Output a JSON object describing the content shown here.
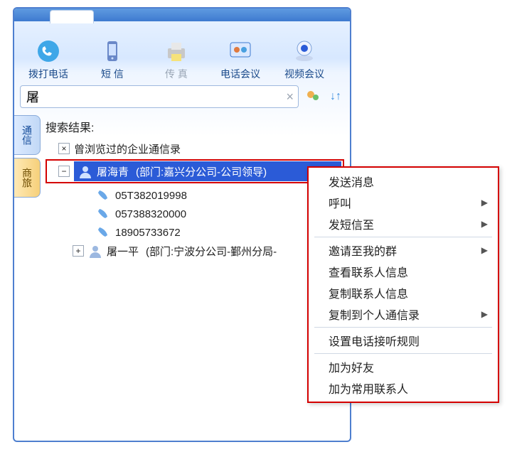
{
  "toolbar": {
    "dial": {
      "label": "拨打电话"
    },
    "sms": {
      "label": "短 信"
    },
    "fax": {
      "label": "传 真"
    },
    "conf": {
      "label": "电话会议"
    },
    "video": {
      "label": "视频会议"
    }
  },
  "search": {
    "value": "屠"
  },
  "side_tabs": {
    "tab1": "通信",
    "tab2": "商旅"
  },
  "tree": {
    "title": "搜索结果:",
    "node1": "曾浏览过的企业通信录",
    "sel_name": "屠海青",
    "sel_dept": "(部门:嘉兴分公司-公司领导)",
    "phones": [
      "05T382019998",
      "057388320000",
      "18905733672"
    ],
    "node2_name": "屠一平",
    "node2_dept": "(部门:宁波分公司-鄞州分局-"
  },
  "ctx": {
    "send_msg": "发送消息",
    "call": "呼叫",
    "sms_to": "发短信至",
    "invite_group": "邀请至我的群",
    "view_info": "查看联系人信息",
    "copy_info": "复制联系人信息",
    "copy_to_personal": "复制到个人通信录",
    "phone_rule": "设置电话接听规则",
    "add_friend": "加为好友",
    "add_common": "加为常用联系人"
  }
}
